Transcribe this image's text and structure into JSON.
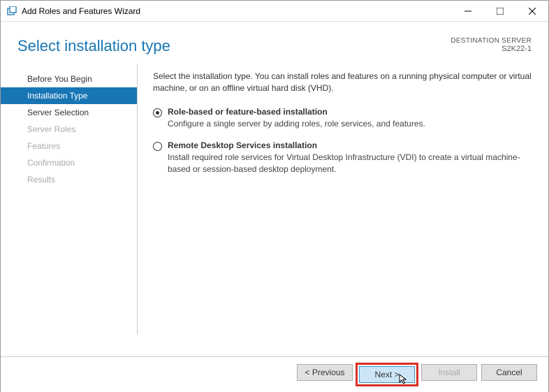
{
  "window": {
    "title": "Add Roles and Features Wizard"
  },
  "header": {
    "title": "Select installation type",
    "dest_label": "DESTINATION SERVER",
    "dest_server": "S2K22-1"
  },
  "nav": {
    "items": [
      {
        "label": "Before You Begin",
        "state": "enabled"
      },
      {
        "label": "Installation Type",
        "state": "active"
      },
      {
        "label": "Server Selection",
        "state": "enabled"
      },
      {
        "label": "Server Roles",
        "state": "disabled"
      },
      {
        "label": "Features",
        "state": "disabled"
      },
      {
        "label": "Confirmation",
        "state": "disabled"
      },
      {
        "label": "Results",
        "state": "disabled"
      }
    ]
  },
  "content": {
    "intro": "Select the installation type. You can install roles and features on a running physical computer or virtual machine, or on an offline virtual hard disk (VHD).",
    "options": [
      {
        "title": "Role-based or feature-based installation",
        "desc": "Configure a single server by adding roles, role services, and features.",
        "checked": true
      },
      {
        "title": "Remote Desktop Services installation",
        "desc": "Install required role services for Virtual Desktop Infrastructure (VDI) to create a virtual machine-based or session-based desktop deployment.",
        "checked": false
      }
    ]
  },
  "footer": {
    "previous": "< Previous",
    "next": "Next >",
    "install": "Install",
    "cancel": "Cancel"
  }
}
